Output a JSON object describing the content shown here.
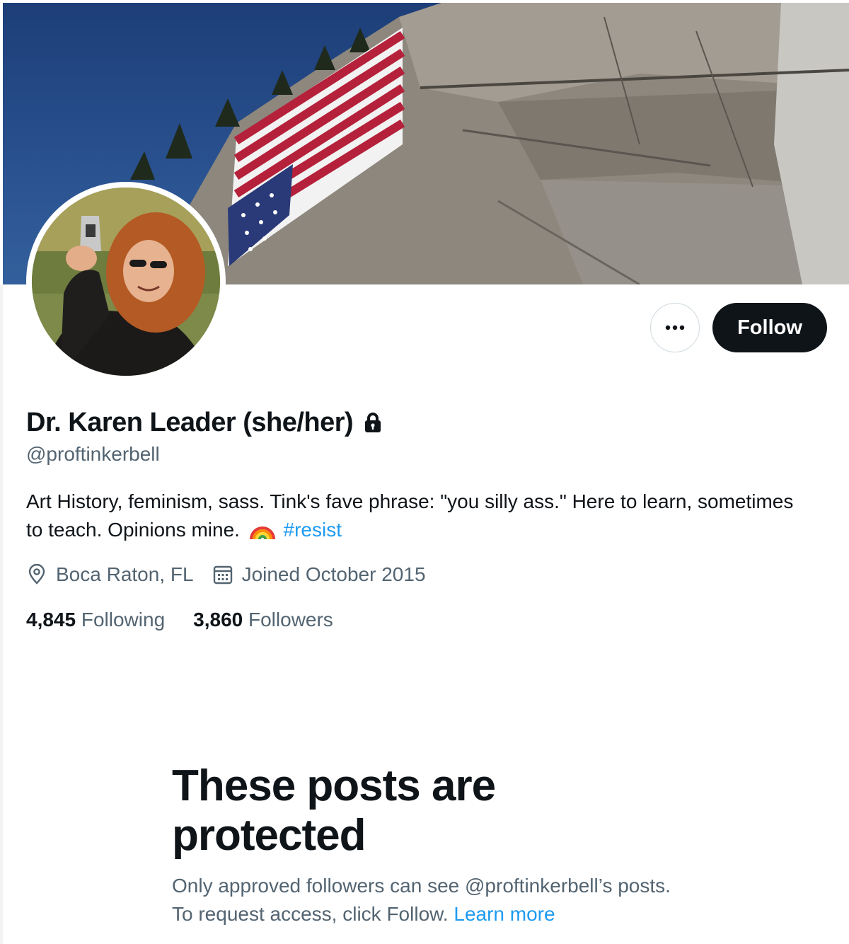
{
  "profile": {
    "display_name": "Dr. Karen Leader (she/her)",
    "handle": "@proftinkerbell",
    "bio_text": "Art History, feminism, sass. Tink's fave phrase: \"you silly ass.\" Here to learn, sometimes to teach. Opinions mine.",
    "bio_emoji_icon": "rainbow-icon",
    "bio_hashtag": "#resist",
    "location": "Boca Raton, FL",
    "joined": "Joined October 2015",
    "following_count": "4,845",
    "following_label": "Following",
    "followers_count": "3,860",
    "followers_label": "Followers",
    "protected_icon": "lock-icon"
  },
  "actions": {
    "more_label": "•••",
    "follow_label": "Follow"
  },
  "protected": {
    "title": "These posts are protected",
    "description": "Only approved followers can see @proftinkerbell’s posts. To request access, click Follow.",
    "learn_more": "Learn more"
  },
  "colors": {
    "text_primary": "#0f1419",
    "text_secondary": "#536471",
    "link": "#1d9bf0",
    "follow_button": "#0f1419"
  }
}
